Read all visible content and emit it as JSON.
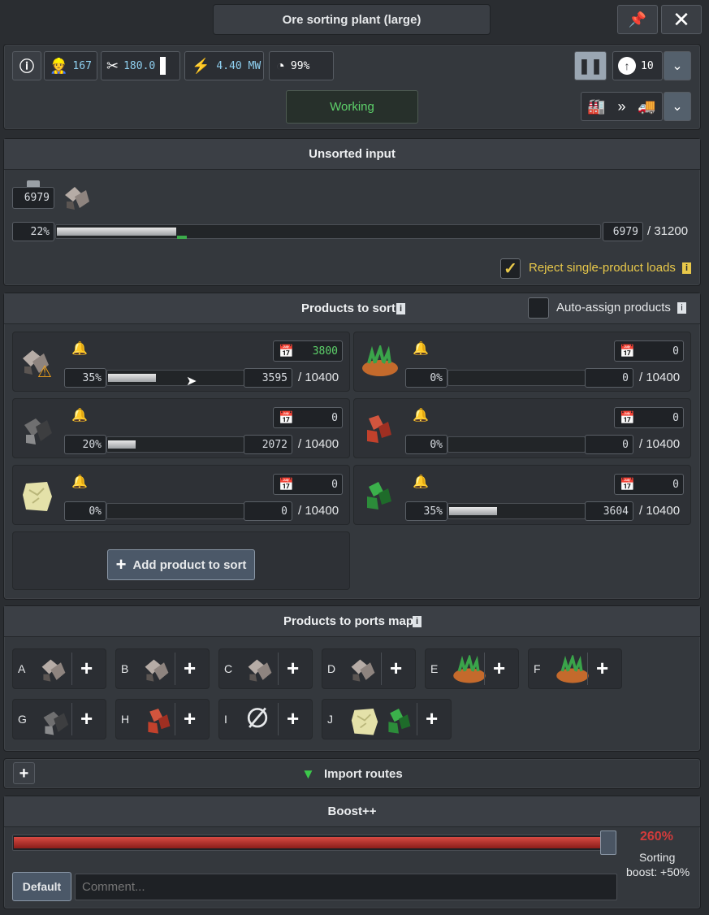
{
  "window": {
    "title": "Ore sorting plant (large)",
    "pin_icon": "pin-icon",
    "close_icon": "close-icon"
  },
  "status": {
    "workers": "167",
    "maintenance": "180.0",
    "power": "4.40 MW",
    "efficiency": "99%",
    "state": "Working",
    "priority": "10",
    "state_color": "#5dd16a"
  },
  "input": {
    "title": "Unsorted input",
    "count_small": "6979",
    "percent": "22%",
    "fill": 0.22,
    "amount": "6979",
    "capacity": "/ 31200",
    "reject_label": "Reject single-product loads",
    "reject_checked": true
  },
  "products": {
    "title": "Products to sort",
    "auto_assign_label": "Auto-assign products",
    "items": [
      {
        "percent": "35%",
        "fill": 0.35,
        "amount": "3595",
        "capacity": "/ 10400",
        "quota": "3800",
        "ore": "mixed-rock",
        "warning": true
      },
      {
        "percent": "0%",
        "fill": 0.0,
        "amount": "0",
        "capacity": "/ 10400",
        "quota": "0",
        "ore": "dirt-grass",
        "warning": false
      },
      {
        "percent": "20%",
        "fill": 0.2,
        "amount": "2072",
        "capacity": "/ 10400",
        "quota": "0",
        "ore": "coal-rock",
        "warning": false
      },
      {
        "percent": "0%",
        "fill": 0.0,
        "amount": "0",
        "capacity": "/ 10400",
        "quota": "0",
        "ore": "red-rock",
        "warning": false
      },
      {
        "percent": "0%",
        "fill": 0.0,
        "amount": "0",
        "capacity": "/ 10400",
        "quota": "0",
        "ore": "limestone",
        "warning": false
      },
      {
        "percent": "35%",
        "fill": 0.35,
        "amount": "3604",
        "capacity": "/ 10400",
        "quota": "0",
        "ore": "green-rock",
        "warning": false
      }
    ],
    "add_label": "Add product to sort"
  },
  "ports": {
    "title": "Products to ports map",
    "list": [
      {
        "letter": "A"
      },
      {
        "letter": "B"
      },
      {
        "letter": "C"
      },
      {
        "letter": "D"
      },
      {
        "letter": "E"
      },
      {
        "letter": "F"
      },
      {
        "letter": "G"
      },
      {
        "letter": "H"
      },
      {
        "letter": "I"
      },
      {
        "letter": "J"
      }
    ]
  },
  "routes": {
    "title": "Import routes"
  },
  "boost": {
    "title": "Boost++",
    "percent": "260%",
    "level": 1.0,
    "desc1": "Sorting",
    "desc2": "boost: +50%",
    "default_label": "Default",
    "comment_placeholder": "Comment...",
    "accent": "#d23b3b"
  }
}
